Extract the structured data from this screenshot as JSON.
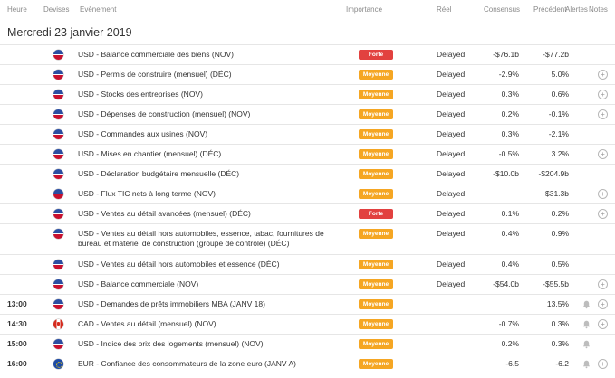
{
  "headers": {
    "time": "Heure",
    "currency": "Devises",
    "event": "Evènement",
    "importance": "Importance",
    "actual": "Réel",
    "consensus": "Consensus",
    "previous": "Précédent",
    "alerts": "Alertes",
    "notes": "Notes"
  },
  "date_label": "Mercredi 23 janvier 2019",
  "rows": [
    {
      "time": "",
      "flag": "us",
      "event": "USD - Balance commerciale des biens (NOV)",
      "importance": "Forte",
      "actual": "Delayed",
      "consensus": "-$76.1b",
      "previous": "-$77.2b",
      "bell": false,
      "plus": false
    },
    {
      "time": "",
      "flag": "us",
      "event": "USD - Permis de construire (mensuel) (DÉC)",
      "importance": "Moyenne",
      "actual": "Delayed",
      "consensus": "-2.9%",
      "previous": "5.0%",
      "bell": false,
      "plus": true
    },
    {
      "time": "",
      "flag": "us",
      "event": "USD - Stocks des entreprises (NOV)",
      "importance": "Moyenne",
      "actual": "Delayed",
      "consensus": "0.3%",
      "previous": "0.6%",
      "bell": false,
      "plus": true
    },
    {
      "time": "",
      "flag": "us",
      "event": "USD - Dépenses de construction (mensuel) (NOV)",
      "importance": "Moyenne",
      "actual": "Delayed",
      "consensus": "0.2%",
      "previous": "-0.1%",
      "bell": false,
      "plus": true
    },
    {
      "time": "",
      "flag": "us",
      "event": "USD - Commandes aux usines (NOV)",
      "importance": "Moyenne",
      "actual": "Delayed",
      "consensus": "0.3%",
      "previous": "-2.1%",
      "bell": false,
      "plus": false
    },
    {
      "time": "",
      "flag": "us",
      "event": "USD - Mises en chantier (mensuel) (DÉC)",
      "importance": "Moyenne",
      "actual": "Delayed",
      "consensus": "-0.5%",
      "previous": "3.2%",
      "bell": false,
      "plus": true
    },
    {
      "time": "",
      "flag": "us",
      "event": "USD - Déclaration budgétaire mensuelle (DÉC)",
      "importance": "Moyenne",
      "actual": "Delayed",
      "consensus": "-$10.0b",
      "previous": "-$204.9b",
      "bell": false,
      "plus": false
    },
    {
      "time": "",
      "flag": "us",
      "event": "USD - Flux TIC nets à long terme (NOV)",
      "importance": "Moyenne",
      "actual": "Delayed",
      "consensus": "",
      "previous": "$31.3b",
      "bell": false,
      "plus": true
    },
    {
      "time": "",
      "flag": "us",
      "event": "USD - Ventes au détail avancées (mensuel) (DÉC)",
      "importance": "Forte",
      "actual": "Delayed",
      "consensus": "0.1%",
      "previous": "0.2%",
      "bell": false,
      "plus": true
    },
    {
      "time": "",
      "flag": "us",
      "event": "USD - Ventes au détail hors automobiles, essence, tabac, fournitures de bureau et matériel de construction (groupe de contrôle) (DÉC)",
      "importance": "Moyenne",
      "actual": "Delayed",
      "consensus": "0.4%",
      "previous": "0.9%",
      "bell": false,
      "plus": false,
      "tall": true
    },
    {
      "time": "",
      "flag": "us",
      "event": "USD - Ventes au détail hors automobiles et essence (DÉC)",
      "importance": "Moyenne",
      "actual": "Delayed",
      "consensus": "0.4%",
      "previous": "0.5%",
      "bell": false,
      "plus": false
    },
    {
      "time": "",
      "flag": "us",
      "event": "USD - Balance commerciale (NOV)",
      "importance": "Moyenne",
      "actual": "Delayed",
      "consensus": "-$54.0b",
      "previous": "-$55.5b",
      "bell": false,
      "plus": true
    },
    {
      "time": "13:00",
      "flag": "us",
      "event": "USD - Demandes de prêts immobiliers MBA (JANV 18)",
      "importance": "Moyenne",
      "actual": "",
      "consensus": "",
      "previous": "13.5%",
      "bell": true,
      "plus": true
    },
    {
      "time": "14:30",
      "flag": "ca",
      "event": "CAD - Ventes au détail (mensuel) (NOV)",
      "importance": "Moyenne",
      "actual": "",
      "consensus": "-0.7%",
      "previous": "0.3%",
      "bell": true,
      "plus": true
    },
    {
      "time": "15:00",
      "flag": "us",
      "event": "USD - Indice des prix des logements (mensuel) (NOV)",
      "importance": "Moyenne",
      "actual": "",
      "consensus": "0.2%",
      "previous": "0.3%",
      "bell": true,
      "plus": false
    },
    {
      "time": "16:00",
      "flag": "eu",
      "event": "EUR - Confiance des consommateurs de la zone euro (JANV A)",
      "importance": "Moyenne",
      "actual": "",
      "consensus": "-6.5",
      "previous": "-6.2",
      "bell": true,
      "plus": true
    }
  ],
  "icons": {
    "bell": "bell-icon",
    "plus": "plus-circle-icon"
  },
  "colors": {
    "moyenne": "#f5a623",
    "forte": "#e2413f",
    "text": "#333333",
    "header": "#8a8a8a"
  }
}
